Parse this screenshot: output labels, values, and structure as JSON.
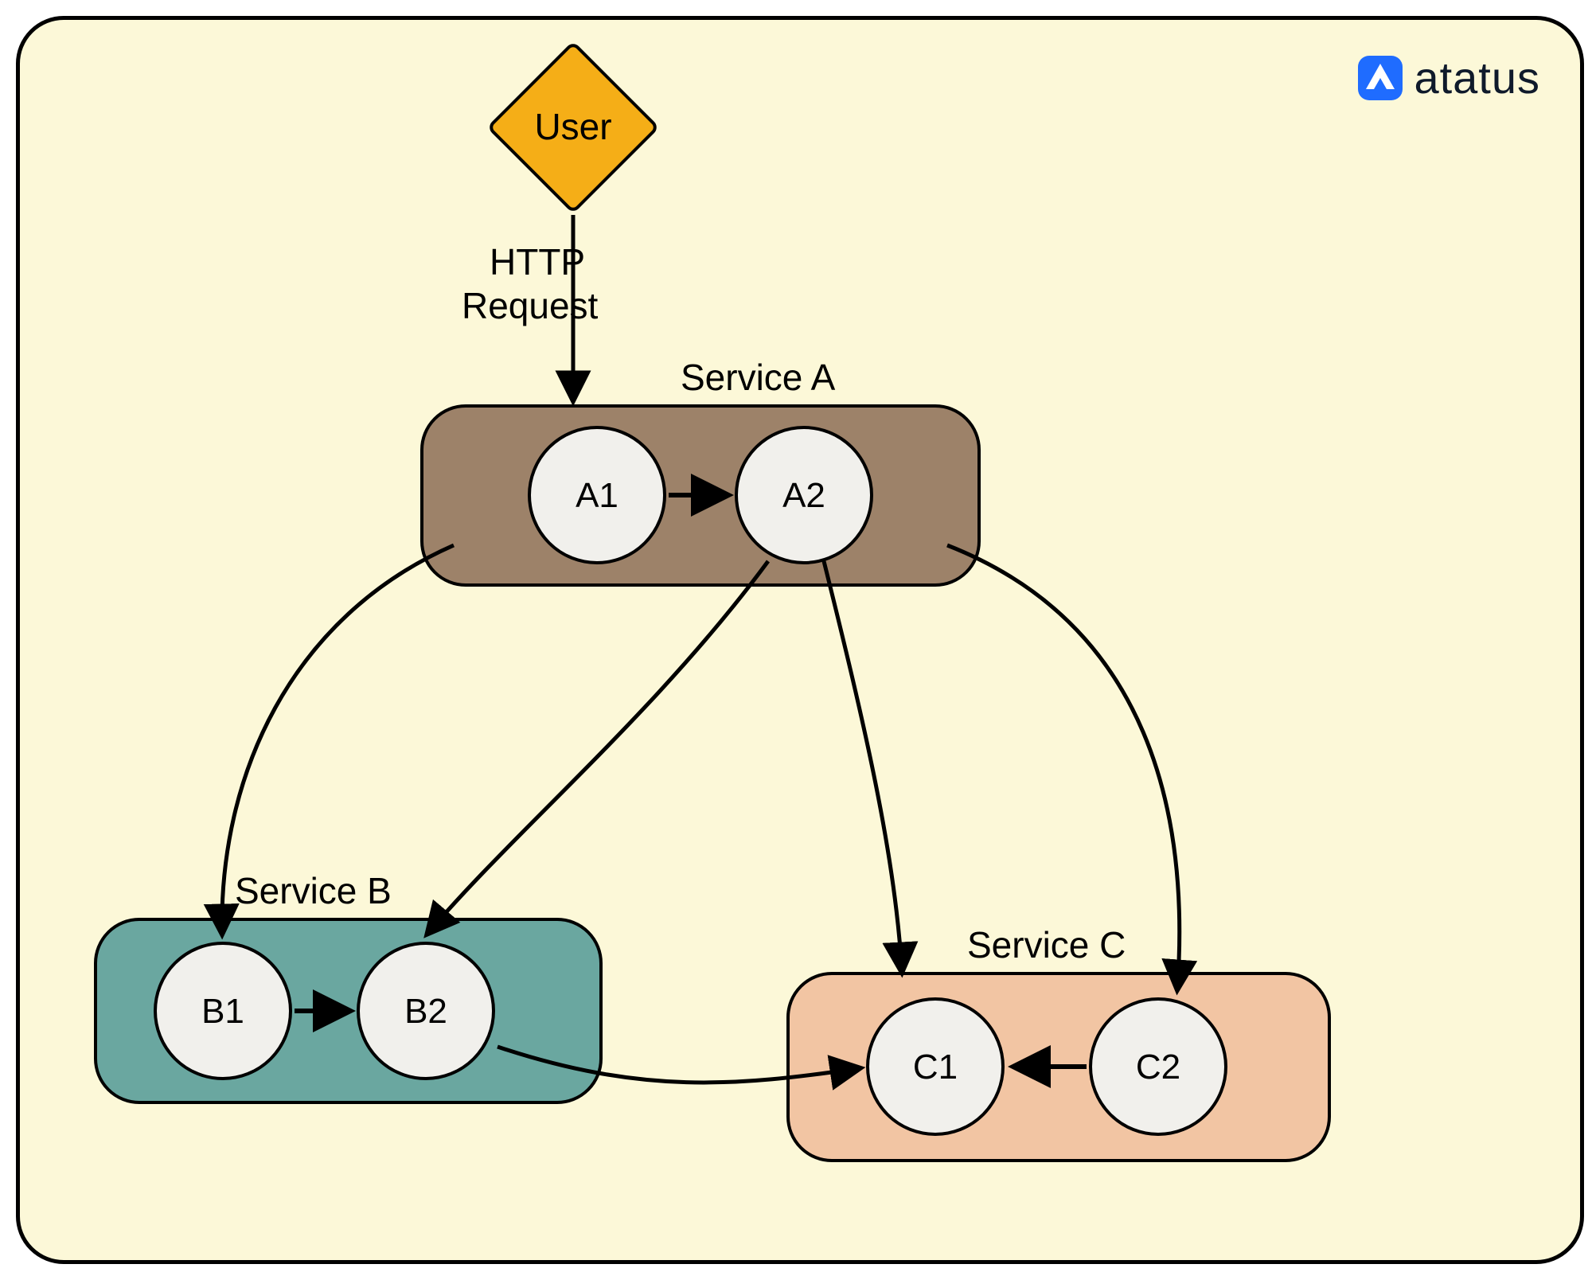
{
  "brand": {
    "name": "atatus"
  },
  "nodes": {
    "user": {
      "label": "User"
    },
    "serviceA": {
      "label": "Service A",
      "pods": [
        "A1",
        "A2"
      ]
    },
    "serviceB": {
      "label": "Service B",
      "pods": [
        "B1",
        "B2"
      ]
    },
    "serviceC": {
      "label": "Service C",
      "pods": [
        "C1",
        "C2"
      ]
    }
  },
  "edges": {
    "user_to_A": {
      "label_line1": "HTTP",
      "label_line2": "Request"
    },
    "A1_to_A2": {},
    "B1_to_B2": {},
    "C2_to_C1": {},
    "Aleft_to_B1": {},
    "A2_to_B2": {},
    "A2_to_C1": {},
    "Aright_to_C2": {},
    "B2_to_C1": {}
  },
  "colors": {
    "bg": "#fcf8d8",
    "user_fill": "#f5ae17",
    "serviceA_fill": "#9d8269",
    "serviceB_fill": "#6aa7a0",
    "serviceC_fill": "#f2c5a3",
    "pod_fill": "#f1f0ec",
    "brand_blue": "#1f6cff"
  }
}
